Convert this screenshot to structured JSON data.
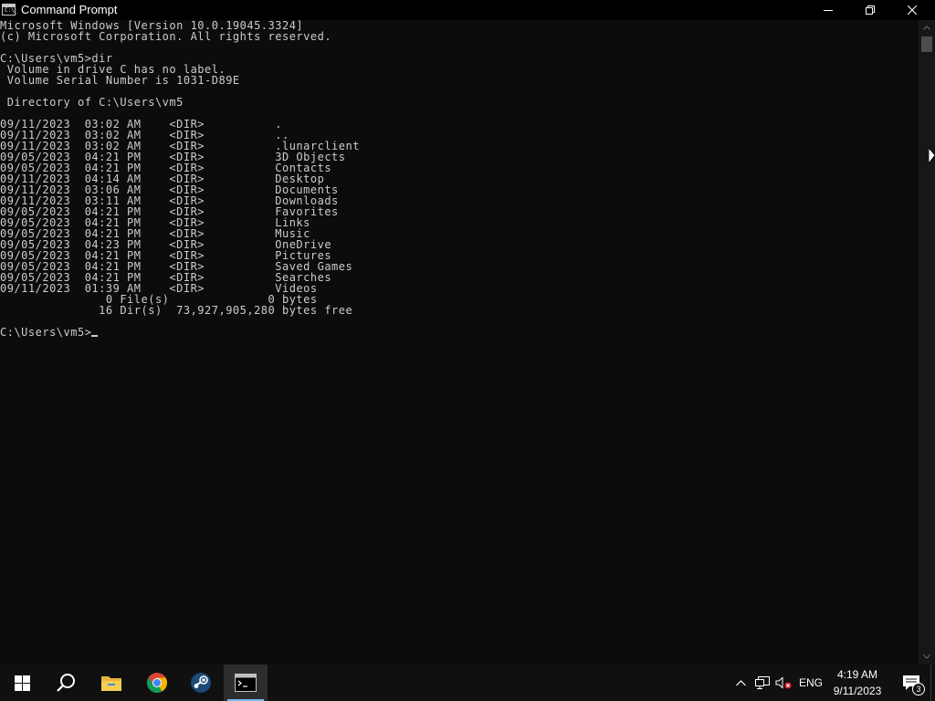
{
  "window": {
    "title": "Command Prompt",
    "icon": "cmd-icon"
  },
  "console": {
    "lines": [
      "Microsoft Windows [Version 10.0.19045.3324]",
      "(c) Microsoft Corporation. All rights reserved.",
      "",
      "C:\\Users\\vm5>dir",
      " Volume in drive C has no label.",
      " Volume Serial Number is 1031-D89E",
      "",
      " Directory of C:\\Users\\vm5",
      "",
      "09/11/2023  03:02 AM    <DIR>          .",
      "09/11/2023  03:02 AM    <DIR>          ..",
      "09/11/2023  03:02 AM    <DIR>          .lunarclient",
      "09/05/2023  04:21 PM    <DIR>          3D Objects",
      "09/05/2023  04:21 PM    <DIR>          Contacts",
      "09/11/2023  04:14 AM    <DIR>          Desktop",
      "09/11/2023  03:06 AM    <DIR>          Documents",
      "09/11/2023  03:11 AM    <DIR>          Downloads",
      "09/05/2023  04:21 PM    <DIR>          Favorites",
      "09/05/2023  04:21 PM    <DIR>          Links",
      "09/05/2023  04:21 PM    <DIR>          Music",
      "09/05/2023  04:23 PM    <DIR>          OneDrive",
      "09/05/2023  04:21 PM    <DIR>          Pictures",
      "09/05/2023  04:21 PM    <DIR>          Saved Games",
      "09/05/2023  04:21 PM    <DIR>          Searches",
      "09/11/2023  01:39 AM    <DIR>          Videos",
      "               0 File(s)              0 bytes",
      "              16 Dir(s)  73,927,905,280 bytes free",
      ""
    ],
    "prompt": "C:\\Users\\vm5>"
  },
  "taskbar": {
    "apps": [
      "start-icon",
      "search-icon",
      "file-explorer-icon",
      "chrome-icon",
      "steam-icon",
      "command-prompt-icon"
    ],
    "language": "ENG",
    "time": "4:19 AM",
    "date": "9/11/2023",
    "notification_count": "3"
  },
  "colors": {
    "console_bg": "#0c0c0c",
    "console_text": "#cccccc",
    "taskbar_bg": "#101010",
    "accent": "#76b9ed"
  }
}
